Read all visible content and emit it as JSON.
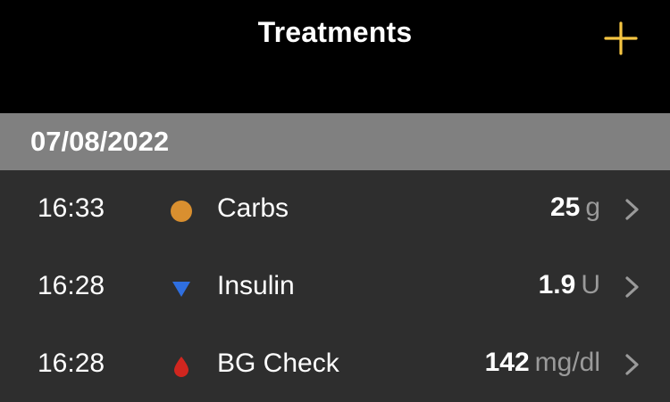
{
  "navbar": {
    "title": "Treatments",
    "add_icon": "plus-icon",
    "accent_color": "#f5c542"
  },
  "section": {
    "date": "07/08/2022"
  },
  "treatments": [
    {
      "time": "16:33",
      "icon": "circle-dot-icon",
      "icon_color": "#d98f2f",
      "label": "Carbs",
      "value": "25",
      "unit": "g"
    },
    {
      "time": "16:28",
      "icon": "triangle-down-icon",
      "icon_color": "#2f6fe0",
      "label": "Insulin",
      "value": "1.9",
      "unit": "U"
    },
    {
      "time": "16:28",
      "icon": "blood-drop-icon",
      "icon_color": "#d0261f",
      "label": "BG Check",
      "value": "142",
      "unit": "mg/dl"
    }
  ]
}
